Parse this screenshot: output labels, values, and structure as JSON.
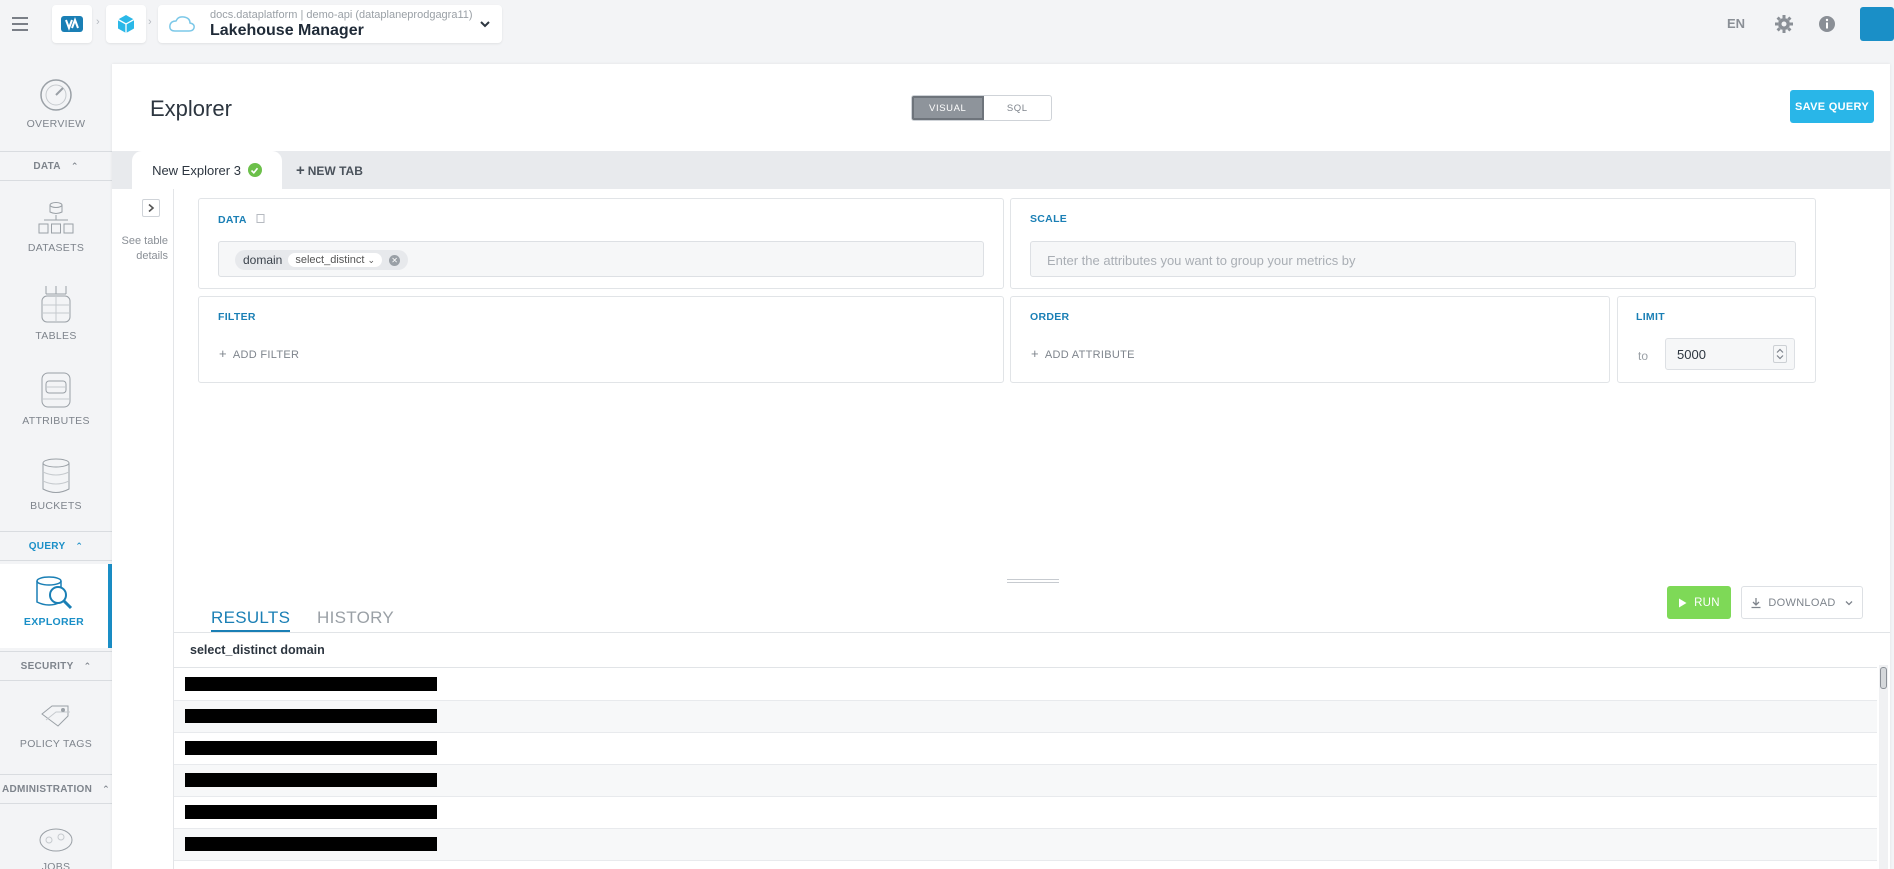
{
  "header": {
    "app_context": "docs.dataplatform | demo-api (dataplaneprodgagra11)",
    "app_title": "Lakehouse Manager",
    "lang": "EN"
  },
  "sidebar": {
    "overview": "OVERVIEW",
    "sections": {
      "data": "DATA",
      "query": "QUERY",
      "security": "SECURITY",
      "administration": "ADMINISTRATION"
    },
    "items": {
      "datasets": "DATASETS",
      "tables": "TABLES",
      "attributes": "ATTRIBUTES",
      "buckets": "BUCKETS",
      "explorer": "EXPLORER",
      "policy_tags": "POLICY TAGS",
      "jobs": "JOBS"
    }
  },
  "page": {
    "title": "Explorer",
    "mode_visual": "VISUAL",
    "mode_sql": "SQL",
    "save_query": "SAVE QUERY"
  },
  "tabs": {
    "active": "New Explorer 3",
    "new_tab": "NEW TAB"
  },
  "details": {
    "label": "See table details"
  },
  "query": {
    "data_label": "DATA",
    "data_chip_name": "domain",
    "data_chip_fn": "select_distinct",
    "scale_label": "SCALE",
    "scale_placeholder": "Enter the attributes you want to group your metrics by",
    "filter_label": "FILTER",
    "add_filter": "ADD FILTER",
    "order_label": "ORDER",
    "add_attribute": "ADD ATTRIBUTE",
    "limit_label": "LIMIT",
    "limit_to": "to",
    "limit_value": "5000"
  },
  "results": {
    "tab_results": "RESULTS",
    "tab_history": "HISTORY",
    "run": "RUN",
    "download": "DOWNLOAD",
    "column": "select_distinct domain",
    "row_count": 6
  },
  "colors": {
    "accent": "#1a8fc7",
    "save": "#29b6e8",
    "run": "#7ed957",
    "check": "#6cc04a"
  }
}
